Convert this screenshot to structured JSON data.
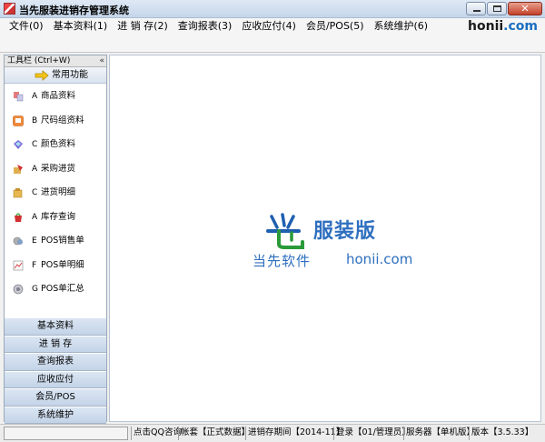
{
  "window": {
    "title": "当先服装进销存管理系统"
  },
  "menubar": {
    "items": [
      "文件(0)",
      "基本资料(1)",
      "进 销 存(2)",
      "查询报表(3)",
      "应收应付(4)",
      "会员/POS(5)",
      "系统维护(6)"
    ],
    "brand_main": "honii",
    "brand_suffix": ".com"
  },
  "toolbar": {
    "title": "工具栏 (Ctrl+W)",
    "collapse_glyph": "«",
    "common_label": "常用功能"
  },
  "functions": [
    {
      "key": "A",
      "label": "商品资料",
      "icon": "product-icon"
    },
    {
      "key": "B",
      "label": "尺码组资料",
      "icon": "size-group-icon"
    },
    {
      "key": "C",
      "label": "颜色资料",
      "icon": "color-icon"
    },
    {
      "key": "A",
      "label": "采购进货",
      "icon": "purchase-icon"
    },
    {
      "key": "C",
      "label": "进货明细",
      "icon": "purchase-detail-icon"
    },
    {
      "key": "A",
      "label": "库存查询",
      "icon": "inventory-icon"
    },
    {
      "key": "E",
      "label": "POS销售单",
      "icon": "pos-sales-icon"
    },
    {
      "key": "F",
      "label": "POS单明细",
      "icon": "pos-detail-icon"
    },
    {
      "key": "G",
      "label": "POS单汇总",
      "icon": "pos-summary-icon"
    }
  ],
  "nav_groups": [
    "基本资料",
    "进 销 存",
    "查询报表",
    "应收应付",
    "会员/POS",
    "系统维护"
  ],
  "logo": {
    "product": "服装版",
    "company": "当先软件",
    "domain": "honii.com"
  },
  "status": {
    "qq": "点击QQ咨询",
    "account": "帐套【正式数据】",
    "period": "进销存期间【2014-11】",
    "login": "登录【01/管理员】",
    "server": "服务器【单机版】",
    "version": "版本【3.5.33】"
  }
}
